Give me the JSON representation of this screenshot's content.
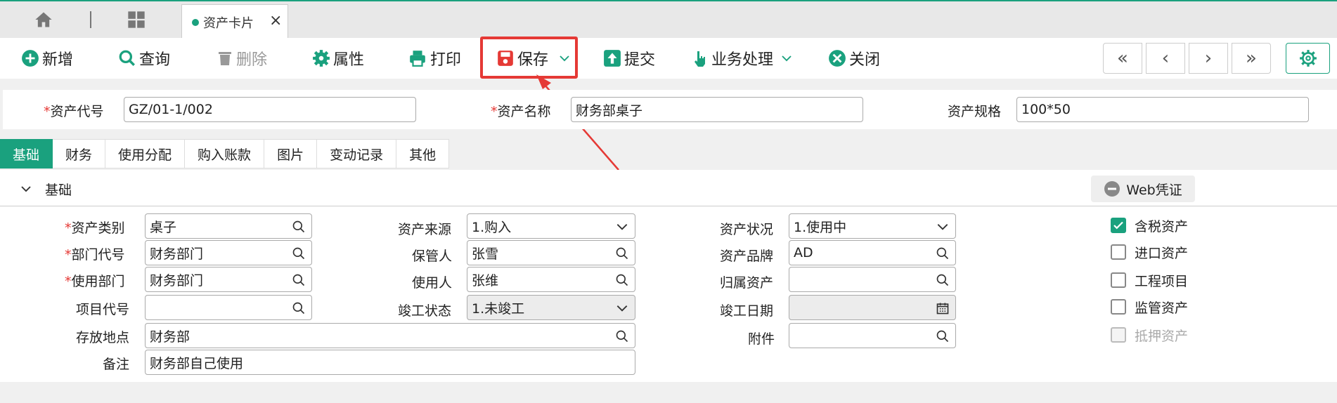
{
  "tabbar": {
    "tab_label": "资产卡片",
    "close": "×"
  },
  "toolbar": {
    "add": "新增",
    "query": "查询",
    "delete": "删除",
    "props": "属性",
    "print": "打印",
    "save": "保存",
    "submit": "提交",
    "business": "业务处理",
    "close": "关闭"
  },
  "nav": {
    "first": "«",
    "prev": "‹",
    "next": "›",
    "last": "»"
  },
  "header": {
    "code_label": "资产代号",
    "code_value": "GZ/01-1/002",
    "name_label": "资产名称",
    "name_value": "财务部桌子",
    "spec_label": "资产规格",
    "spec_value": "100*50"
  },
  "subtabs": [
    "基础",
    "财务",
    "使用分配",
    "购入账款",
    "图片",
    "变动记录",
    "其他"
  ],
  "section": {
    "title": "基础",
    "web_voucher": "Web凭证",
    "fields": {
      "category_label": "资产类别",
      "category_value": "桌子",
      "dept_code_label": "部门代号",
      "dept_code_value": "财务部门",
      "use_dept_label": "使用部门",
      "use_dept_value": "财务部门",
      "project_label": "项目代号",
      "project_value": "",
      "location_label": "存放地点",
      "location_value": "财务部",
      "remark_label": "备注",
      "remark_value": "财务部自己使用",
      "source_label": "资产来源",
      "source_value": "1.购入",
      "keeper_label": "保管人",
      "keeper_value": "张雪",
      "user_label": "使用人",
      "user_value": "张维",
      "completion_label": "竣工状态",
      "completion_value": "1.未竣工",
      "status_label": "资产状况",
      "status_value": "1.使用中",
      "brand_label": "资产品牌",
      "brand_value": "AD",
      "belong_label": "归属资产",
      "belong_value": "",
      "completion_date_label": "竣工日期",
      "completion_date_value": "",
      "attachment_label": "附件",
      "attachment_value": ""
    },
    "checkboxes": [
      {
        "label": "含税资产",
        "checked": true
      },
      {
        "label": "进口资产",
        "checked": false
      },
      {
        "label": "工程项目",
        "checked": false
      },
      {
        "label": "监管资产",
        "checked": false
      },
      {
        "label": "抵押资产",
        "checked": false
      }
    ]
  },
  "colors": {
    "accent": "#1aa17e",
    "required": "#e53935",
    "highlight": "#e53935"
  }
}
